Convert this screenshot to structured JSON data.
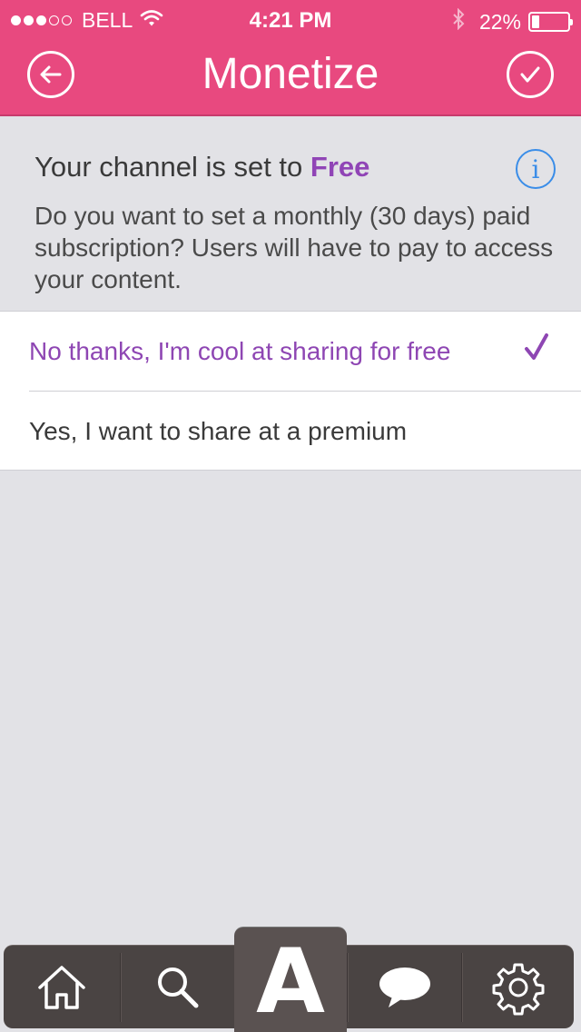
{
  "status_bar": {
    "signal_filled": 3,
    "signal_total": 5,
    "carrier": "BELL",
    "time": "4:21 PM",
    "battery_percent": "22%",
    "battery_level": 0.22
  },
  "nav": {
    "title": "Monetize",
    "back_icon": "back-arrow-circle-icon",
    "done_icon": "checkmark-circle-icon"
  },
  "intro": {
    "heading_prefix": "Your channel is set to ",
    "current_plan": "Free",
    "description": "Do you want to set a monthly (30 days) paid subscription? Users will have to pay to access your content."
  },
  "options": [
    {
      "label": "No thanks, I'm cool at sharing for free",
      "selected": true
    },
    {
      "label": "Yes, I want to share at a premium",
      "selected": false
    }
  ],
  "tabbar": {
    "tabs": [
      "home-icon",
      "search-icon",
      "center-logo",
      "chat-icon",
      "gear-icon"
    ],
    "center_letter": "A"
  },
  "colors": {
    "header": "#e8497f",
    "accent_purple": "#8e46b3",
    "info_blue": "#3a8de8",
    "tabbar": "#4a4443"
  }
}
